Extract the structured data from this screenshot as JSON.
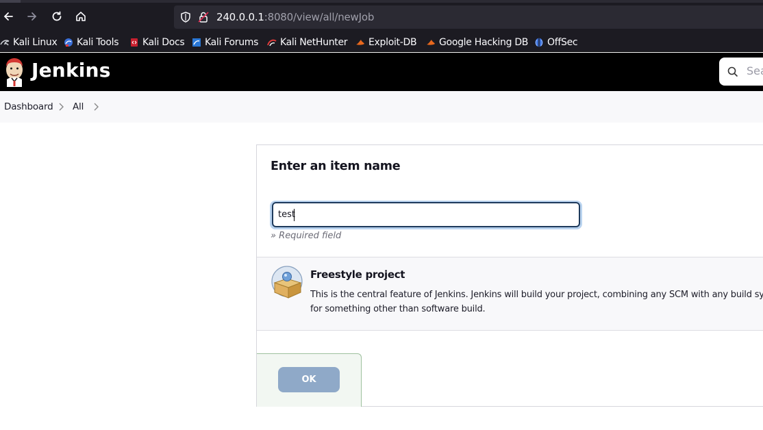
{
  "browser": {
    "url_host": "240.0.0.1",
    "url_rest": ":8080/view/all/newJob",
    "bookmarks": [
      {
        "label": "Kali Linux",
        "icon": "kali-dragon-icon"
      },
      {
        "label": "Kali Tools",
        "icon": "kali-tools-icon"
      },
      {
        "label": "Kali Docs",
        "icon": "kali-docs-icon"
      },
      {
        "label": "Kali Forums",
        "icon": "kali-forums-icon"
      },
      {
        "label": "Kali NetHunter",
        "icon": "kali-nethunter-icon"
      },
      {
        "label": "Exploit-DB",
        "icon": "exploit-db-icon"
      },
      {
        "label": "Google Hacking DB",
        "icon": "ghdb-icon"
      },
      {
        "label": "OffSec",
        "icon": "offsec-icon"
      }
    ]
  },
  "header": {
    "title": "Jenkins",
    "search_placeholder": "Sea"
  },
  "breadcrumb": [
    "Dashboard",
    "All"
  ],
  "form": {
    "title": "Enter an item name",
    "item_name": "test",
    "required_note": "» Required field"
  },
  "options": [
    {
      "title": "Freestyle project",
      "description_line1": "This is the central feature of Jenkins. Jenkins will build your project, combining any SCM with any build system, and this can be even used",
      "description_line2": "for something other than software build.",
      "icon": "freestyle-project-icon"
    }
  ],
  "ok_label": "OK",
  "colors": {
    "header_bg": "#000000",
    "ok_button": "#8fa9c8",
    "input_border": "#1e3a5c"
  }
}
